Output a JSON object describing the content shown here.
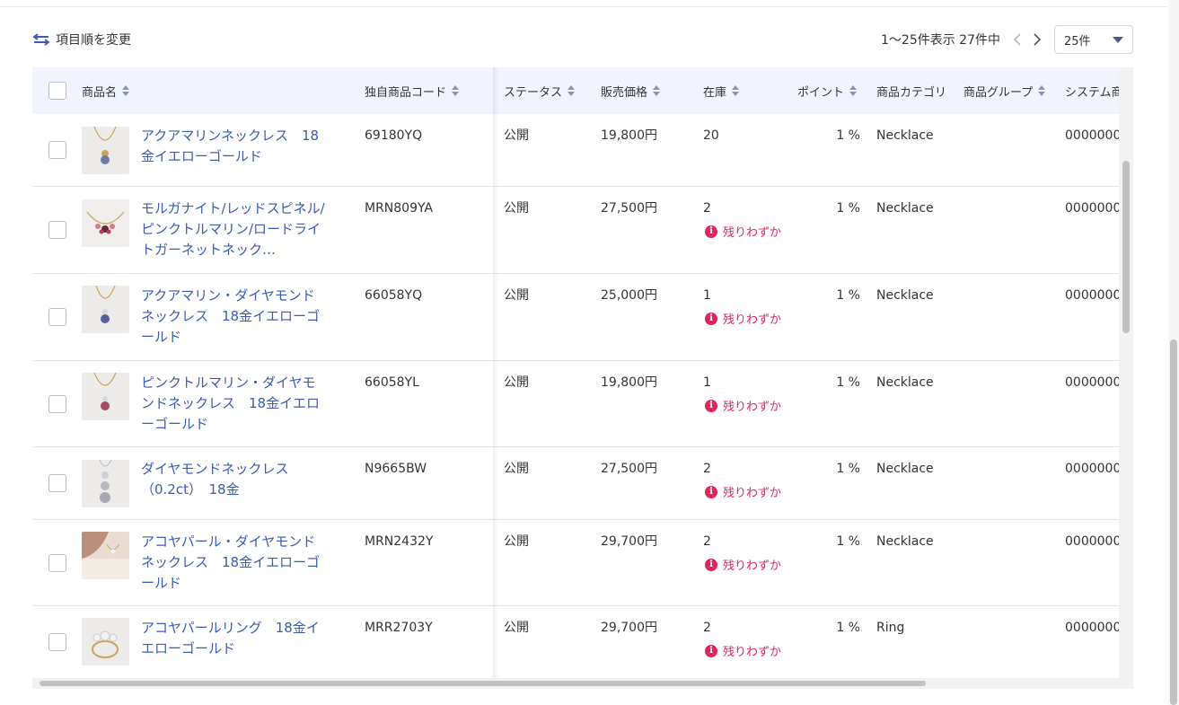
{
  "toolbar": {
    "reorder_label": "項目順を変更",
    "pager_text": "1〜25件表示 27件中",
    "per_page_value": "25件"
  },
  "columns": {
    "name": "商品名",
    "code": "独自商品コード",
    "status": "ステータス",
    "price": "販売価格",
    "stock": "在庫",
    "point": "ポイント",
    "category": "商品カテゴリ",
    "group": "商品グループ",
    "system": "システム商"
  },
  "low_stock_label": "残りわずか",
  "colors": {
    "accent": "#3c5bb0",
    "warning": "#e0245e",
    "header_bg": "#f1f4fd"
  },
  "rows": [
    {
      "name": "アクアマリンネックレス　18金イエローゴールド",
      "code": "69180YQ",
      "status": "公開",
      "price": "19,800円",
      "stock": "20",
      "low": false,
      "point": "1 %",
      "category": "Necklace",
      "group": "",
      "system": "0000000"
    },
    {
      "name": "モルガナイト/レッドスピネル/ピンクトルマリン/ロードライトガーネットネック…",
      "code": "MRN809YA",
      "status": "公開",
      "price": "27,500円",
      "stock": "2",
      "low": true,
      "point": "1 %",
      "category": "Necklace",
      "group": "",
      "system": "0000000"
    },
    {
      "name": "アクアマリン・ダイヤモンドネックレス　18金イエローゴールド",
      "code": "66058YQ",
      "status": "公開",
      "price": "25,000円",
      "stock": "1",
      "low": true,
      "point": "1 %",
      "category": "Necklace",
      "group": "",
      "system": "0000000"
    },
    {
      "name": "ピンクトルマリン・ダイヤモンドネックレス　18金イエローゴールド",
      "code": "66058YL",
      "status": "公開",
      "price": "19,800円",
      "stock": "1",
      "low": true,
      "point": "1 %",
      "category": "Necklace",
      "group": "",
      "system": "0000000"
    },
    {
      "name": "ダイヤモンドネックレス（0.2ct）　18金",
      "code": "N9665BW",
      "status": "公開",
      "price": "27,500円",
      "stock": "2",
      "low": true,
      "point": "1 %",
      "category": "Necklace",
      "group": "",
      "system": "0000000"
    },
    {
      "name": "アコヤパール・ダイヤモンドネックレス　18金イエローゴールド",
      "code": "MRN2432Y",
      "status": "公開",
      "price": "29,700円",
      "stock": "2",
      "low": true,
      "point": "1 %",
      "category": "Necklace",
      "group": "",
      "system": "0000000"
    },
    {
      "name": "アコヤパールリング　18金イエローゴールド",
      "code": "MRR2703Y",
      "status": "公開",
      "price": "29,700円",
      "stock": "2",
      "low": true,
      "point": "1 %",
      "category": "Ring",
      "group": "",
      "system": "0000000"
    }
  ]
}
